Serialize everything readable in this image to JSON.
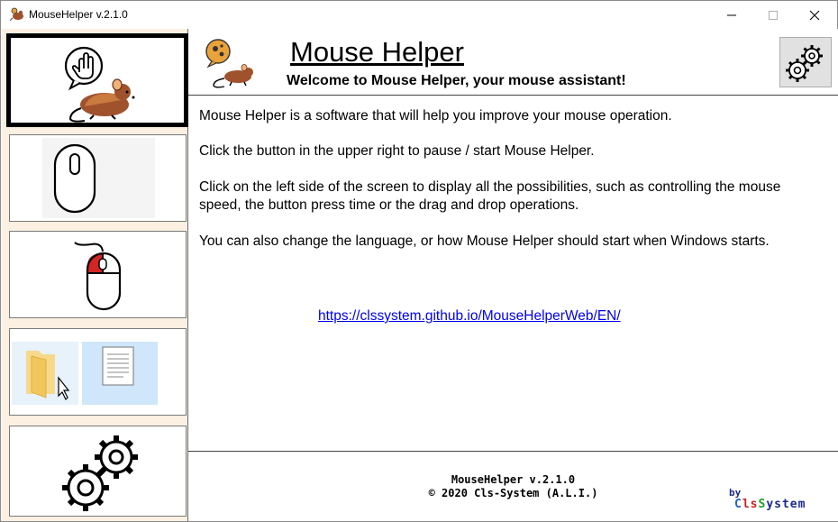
{
  "window": {
    "title": "MouseHelper v.2.1.0"
  },
  "header": {
    "title": "Mouse Helper",
    "subtitle": "Welcome to Mouse Helper, your mouse assistant!"
  },
  "sidebar": {
    "items": [
      {
        "name": "home",
        "selected": true
      },
      {
        "name": "mouse-speed"
      },
      {
        "name": "button-press-time"
      },
      {
        "name": "drag-and-drop"
      },
      {
        "name": "settings"
      }
    ]
  },
  "main": {
    "paragraphs": [
      "Mouse Helper is a software that will help you improve your mouse operation.",
      "Click the button in the upper right to pause / start Mouse Helper.",
      "Click on the left side of the screen to display all the possibilities, such as controlling the mouse speed, the button press time or the drag and drop operations.",
      "You can also change the language, or how Mouse Helper should start when Windows starts."
    ],
    "link": "https://clssystem.github.io/MouseHelperWeb/EN/"
  },
  "footer": {
    "version": "MouseHelper v.2.1.0",
    "copyright": "©  2020 Cls-System (A.L.I.)",
    "by": "by",
    "brand": "ClsSystem"
  },
  "colors": {
    "sidebar_bg": "#fbf0e1",
    "link": "#0000ee",
    "mouse_brown": "#a0522d",
    "accent_red": "#cc1f1f"
  }
}
